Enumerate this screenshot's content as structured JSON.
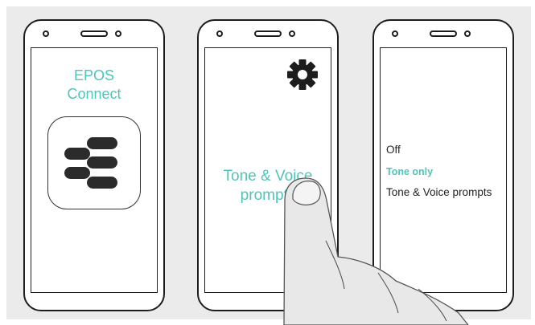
{
  "phones": {
    "phone1": {
      "app_title_line1": "EPOS",
      "app_title_line2": "Connect",
      "app_icon": "epos-connect-logo-icon"
    },
    "phone2": {
      "settings_icon": "gear-icon",
      "menu_item_line1": "Tone & Voice",
      "menu_item_line2": "prompts"
    },
    "phone3": {
      "options": [
        "Off",
        "Tone only",
        "Tone & Voice prompts"
      ],
      "selected_option": "Tone only"
    }
  },
  "colors": {
    "accent": "#4fc4bb",
    "outline": "#1d1d1d",
    "background_panel": "#ebebeb",
    "hand_fill": "#e8e8e8"
  }
}
